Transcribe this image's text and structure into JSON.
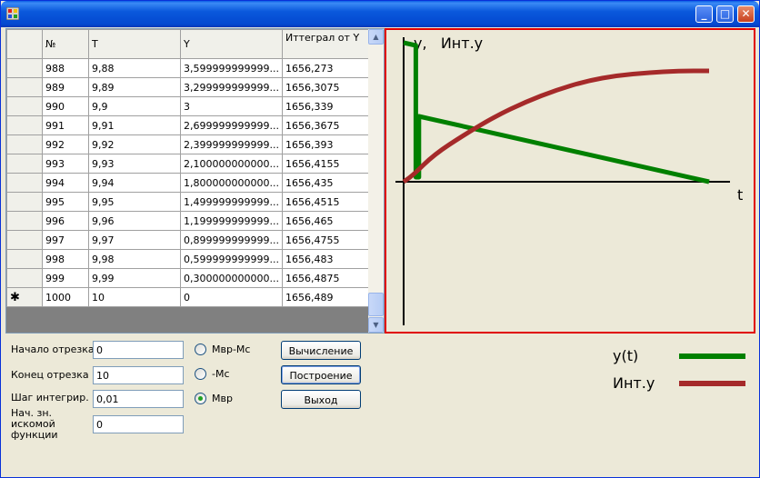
{
  "window": {
    "icons": {
      "app": "app-icon",
      "minimize": "minimize-icon",
      "maximize": "maximize-icon",
      "close": "close-icon"
    },
    "buttons": {
      "min_glyph": "_",
      "max_glyph": "□",
      "close_glyph": "✕"
    }
  },
  "grid": {
    "columns": [
      "№",
      "T",
      "Y",
      "Иттеграл от Y"
    ],
    "rows": [
      [
        "988",
        "9,88",
        "3,599999999999...",
        "1656,273"
      ],
      [
        "989",
        "9,89",
        "3,299999999999...",
        "1656,3075"
      ],
      [
        "990",
        "9,9",
        "3",
        "1656,339"
      ],
      [
        "991",
        "9,91",
        "2,699999999999...",
        "1656,3675"
      ],
      [
        "992",
        "9,92",
        "2,399999999999...",
        "1656,393"
      ],
      [
        "993",
        "9,93",
        "2,100000000000...",
        "1656,4155"
      ],
      [
        "994",
        "9,94",
        "1,800000000000...",
        "1656,435"
      ],
      [
        "995",
        "9,95",
        "1,499999999999...",
        "1656,4515"
      ],
      [
        "996",
        "9,96",
        "1,199999999999...",
        "1656,465"
      ],
      [
        "997",
        "9,97",
        "0,899999999999...",
        "1656,4755"
      ],
      [
        "998",
        "9,98",
        "0,599999999999...",
        "1656,483"
      ],
      [
        "999",
        "9,99",
        "0,300000000000...",
        "1656,4875"
      ],
      [
        "1000",
        "10",
        "0",
        "1656,489"
      ]
    ],
    "new_row_marker": "✱",
    "scroll": {
      "up_glyph": "▲",
      "down_glyph": "▼"
    }
  },
  "form": {
    "start_label": "Начало отрезка",
    "start_value": "0",
    "end_label": "Конец отрезка",
    "end_value": "10",
    "step_label": "Шаг интегрир.",
    "step_value": "0,01",
    "init_label": "Нач. зн. искомой функции",
    "init_value": "0",
    "radios": [
      {
        "label": "Мвр-Мс",
        "checked": false
      },
      {
        "label": "-Мс",
        "checked": false
      },
      {
        "label": "Мвр",
        "checked": true
      }
    ],
    "buttons": {
      "compute": "Вычисление",
      "build": "Построение",
      "exit": "Выход"
    }
  },
  "legend": {
    "items": [
      {
        "label": "y(t)",
        "color": "#008000"
      },
      {
        "label": "Инт.y",
        "color": "#a52a2a"
      }
    ]
  },
  "chart_data": {
    "type": "line",
    "y_axis_label": "y,   Инт.y",
    "x_axis_label": "t",
    "colors": {
      "y": "#008000",
      "int": "#a52a2a",
      "border": "#e00000"
    },
    "series": [
      {
        "name": "y(t)",
        "x": [
          0,
          0.4,
          0.4,
          0.5,
          0.5,
          10
        ],
        "y": [
          153,
          150,
          5,
          5,
          72,
          0
        ]
      },
      {
        "name": "Инт.y",
        "x": [
          0,
          0.3,
          1,
          2,
          3,
          4,
          5,
          6,
          7,
          8,
          9,
          10
        ],
        "y": [
          0,
          7,
          30,
          52,
          72,
          88,
          101,
          111,
          117,
          120,
          122,
          122
        ]
      }
    ]
  }
}
